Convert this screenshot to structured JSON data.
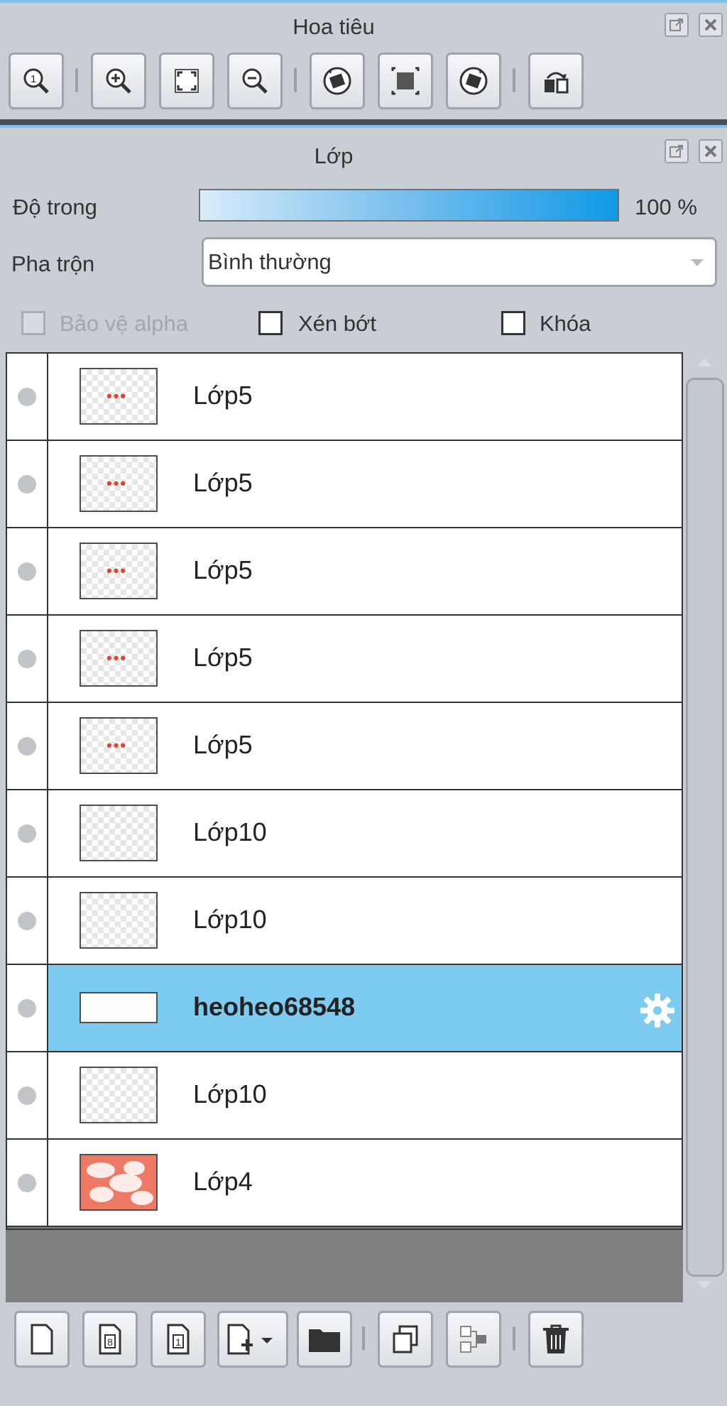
{
  "navigator": {
    "title": "Hoa tiêu",
    "tools": [
      {
        "icon": "zoom-actual-icon"
      },
      {
        "icon": "zoom-in-icon"
      },
      {
        "icon": "fit-screen-icon"
      },
      {
        "icon": "zoom-out-icon"
      },
      {
        "icon": "rotate-left-icon"
      },
      {
        "icon": "reset-view-icon"
      },
      {
        "icon": "rotate-right-icon"
      },
      {
        "icon": "flip-horizontal-icon"
      }
    ]
  },
  "layers_panel": {
    "title": "Lớp",
    "opacity_label": "Độ trong",
    "opacity_value": "100 %",
    "opacity_fraction": 1.0,
    "blend_label": "Pha trộn",
    "blend_mode": "Bình thường",
    "protect_alpha_label": "Bảo vệ alpha",
    "clipping_label": "Xén bớt",
    "lock_label": "Khóa",
    "accent_color": "#7ecbf2"
  },
  "layers": [
    {
      "name": "Lớp5",
      "thumb": "dots"
    },
    {
      "name": "Lớp5",
      "thumb": "dots"
    },
    {
      "name": "Lớp5",
      "thumb": "dots"
    },
    {
      "name": "Lớp5",
      "thumb": "dots"
    },
    {
      "name": "Lớp5",
      "thumb": "dots"
    },
    {
      "name": "Lớp10",
      "thumb": "empty"
    },
    {
      "name": "Lớp10",
      "thumb": "empty"
    },
    {
      "name": "heoheo68548",
      "thumb": "short",
      "selected": true
    },
    {
      "name": "Lớp10",
      "thumb": "empty"
    },
    {
      "name": "Lớp4",
      "thumb": "red"
    }
  ],
  "bottom_tools": [
    {
      "icon": "new-layer-icon"
    },
    {
      "icon": "new-8bit-layer-icon"
    },
    {
      "icon": "new-1bit-layer-icon"
    },
    {
      "icon": "add-layer-menu-icon"
    },
    {
      "icon": "new-folder-icon"
    },
    {
      "icon": "duplicate-layer-icon"
    },
    {
      "icon": "merge-down-icon"
    },
    {
      "icon": "delete-layer-icon"
    }
  ]
}
